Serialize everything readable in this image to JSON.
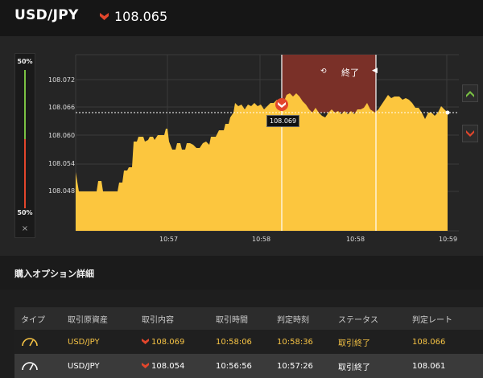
{
  "header": {
    "pair": "USD/JPY",
    "price": "108.065",
    "direction_icon": "low-arrow-icon"
  },
  "gauge": {
    "top_label": "50%",
    "bottom_label": "50%",
    "close": "×",
    "high_percent": 50,
    "low_percent": 50
  },
  "chart": {
    "y_ticks": [
      "108.072",
      "108.066",
      "108.060",
      "108.054",
      "108.048"
    ],
    "x_ticks": [
      "10:57",
      "10:58",
      "10:58",
      "10:59"
    ],
    "entry_rate": "108.069",
    "end_label": "終了",
    "current_rate_line": "108.065",
    "colors": {
      "fill": "#fcc63e",
      "band": "#7a3028",
      "high": "#7ac143",
      "low": "#e2462c"
    }
  },
  "section": {
    "title": "購入オプション詳細"
  },
  "table": {
    "headers": [
      "タイプ",
      "取引原資産",
      "取引内容",
      "取引時間",
      "判定時刻",
      "ステータス",
      "判定レート"
    ],
    "rows": [
      {
        "type_icon": "gauge-icon",
        "asset": "USD/JPY",
        "content": "108.069",
        "trade_time": "10:58:06",
        "judge_time": "10:58:36",
        "status": "取引終了",
        "rate": "108.066"
      },
      {
        "type_icon": "gauge-icon",
        "asset": "USD/JPY",
        "content": "108.054",
        "trade_time": "10:56:56",
        "judge_time": "10:57:26",
        "status": "取引終了",
        "rate": "108.061"
      }
    ]
  }
}
